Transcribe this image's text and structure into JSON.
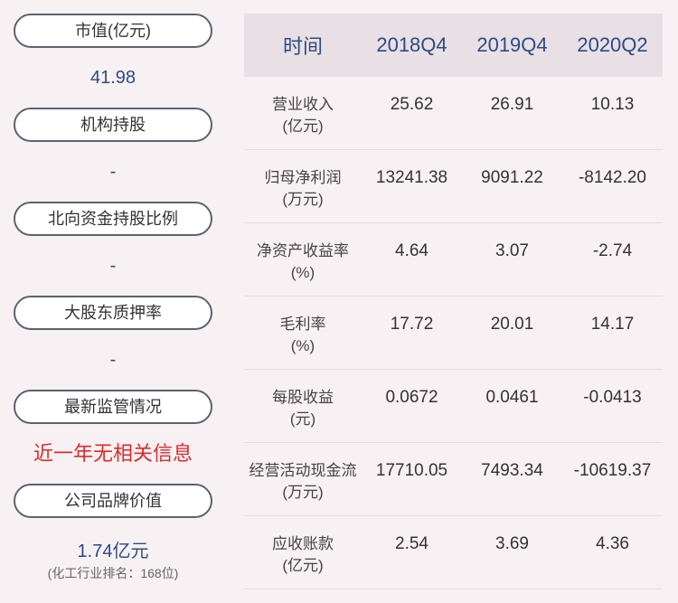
{
  "left_panel": [
    {
      "label": "市值(亿元)",
      "value": "41.98"
    },
    {
      "label": "机构持股",
      "value": "-"
    },
    {
      "label": "北向资金持股比例",
      "value": "-"
    },
    {
      "label": "大股东质押率",
      "value": "-"
    },
    {
      "label": "最新监管情况",
      "value": "近一年无相关信息"
    },
    {
      "label": "公司品牌价值",
      "value": "1.74亿元",
      "note": "(化工行业排名：168位)"
    }
  ],
  "table": {
    "header": [
      "时间",
      "2018Q4",
      "2019Q4",
      "2020Q2"
    ],
    "rows": [
      {
        "label": "营业收入",
        "unit": "(亿元)",
        "values": [
          "25.62",
          "26.91",
          "10.13"
        ]
      },
      {
        "label": "归母净利润",
        "unit": "(万元)",
        "values": [
          "13241.38",
          "9091.22",
          "-8142.20"
        ]
      },
      {
        "label": "净资产收益率",
        "unit": "(%)",
        "values": [
          "4.64",
          "3.07",
          "-2.74"
        ]
      },
      {
        "label": "毛利率",
        "unit": "(%)",
        "values": [
          "17.72",
          "20.01",
          "14.17"
        ]
      },
      {
        "label": "每股收益",
        "unit": "(元)",
        "values": [
          "0.0672",
          "0.0461",
          "-0.0413"
        ]
      },
      {
        "label": "经营活动现金流",
        "unit": "(万元)",
        "values": [
          "17710.05",
          "7493.34",
          "-10619.37"
        ]
      },
      {
        "label": "应收账款",
        "unit": "(亿元)",
        "values": [
          "2.54",
          "3.69",
          "4.36"
        ]
      }
    ]
  },
  "colors": {
    "accent": "#2f4a84",
    "alert": "#d92c2c",
    "background": "#f7f1f3",
    "header_bg": "#e8e0e5"
  }
}
